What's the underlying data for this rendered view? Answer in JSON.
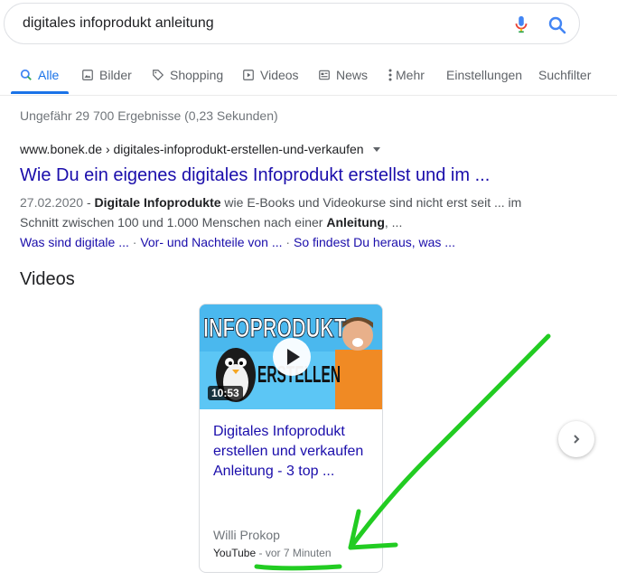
{
  "search": {
    "query": "digitales infoprodukt anleitung"
  },
  "tabs": [
    {
      "label": "Alle",
      "icon": "search-icon"
    },
    {
      "label": "Bilder",
      "icon": "image-icon"
    },
    {
      "label": "Shopping",
      "icon": "tag-icon"
    },
    {
      "label": "Videos",
      "icon": "play-icon"
    },
    {
      "label": "News",
      "icon": "newspaper-icon"
    },
    {
      "label": "Mehr",
      "icon": "more-vertical-icon"
    },
    {
      "label": "Einstellungen"
    },
    {
      "label": "Suchfilter"
    }
  ],
  "stats": "Ungefähr 29 700 Ergebnisse (0,23 Sekunden)",
  "result": {
    "cite": "www.bonek.de › digitales-infoprodukt-erstellen-und-verkaufen",
    "title": "Wie Du ein eigenes digitales Infoprodukt erstellst und im ...",
    "date": "27.02.2020",
    "snippet_1": " - ",
    "bold_1": "Digitale Infoprodukte",
    "snippet_2": " wie E-Books und Videokurse sind nicht erst seit ... im Schnitt zwischen 100 und 1.000 Menschen nach einer ",
    "bold_2": "Anleitung",
    "snippet_3": ", ...",
    "sitelinks": [
      "Was sind digitale ...",
      "Vor- und Nachteile von ...",
      "So findest Du heraus, was ..."
    ],
    "sitelink_sep": " · "
  },
  "videos": {
    "heading": "Videos",
    "card": {
      "thumb_text_1": "INFOPRODUKT",
      "thumb_text_2": "ERSTELLEN",
      "duration": "10:53",
      "title": "Digitales Infoprodukt erstellen und verkaufen Anleitung - 3 top ...",
      "channel": "Willi Prokop",
      "source": "YouTube",
      "age": " - vor 7 Minuten"
    }
  },
  "colors": {
    "accent": "#1a73e8",
    "link": "#1a0dab",
    "annotation": "#22cc22"
  }
}
